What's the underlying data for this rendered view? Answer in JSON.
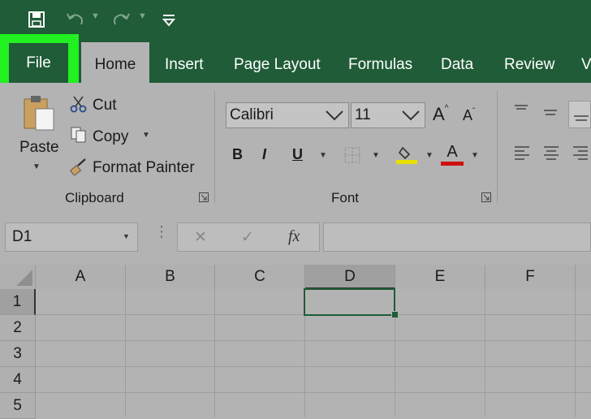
{
  "quick_access": {
    "save_icon": "save-icon",
    "undo_icon": "undo-icon",
    "redo_icon": "redo-icon",
    "customize_icon": "customize-qat-icon"
  },
  "tabs": {
    "file": "File",
    "home": "Home",
    "insert": "Insert",
    "page_layout": "Page Layout",
    "formulas": "Formulas",
    "data": "Data",
    "review": "Review",
    "view_partial": "V"
  },
  "clipboard": {
    "paste": "Paste",
    "cut": "Cut",
    "copy": "Copy",
    "format_painter": "Format Painter",
    "group_label": "Clipboard"
  },
  "font": {
    "family": "Calibri",
    "size": "11",
    "bold": "B",
    "italic": "I",
    "underline": "U",
    "grow": "A",
    "shrink": "A",
    "font_color": "A",
    "group_label": "Font",
    "highlight_color": "#e8e000",
    "font_color_value": "#d01010"
  },
  "formula_bar": {
    "name_box": "D1",
    "cancel": "✕",
    "enter": "✓",
    "fx": "fx",
    "value": ""
  },
  "grid": {
    "columns": [
      "A",
      "B",
      "C",
      "D",
      "E",
      "F"
    ],
    "rows": [
      "1",
      "2",
      "3",
      "4",
      "5"
    ],
    "selected_cell": "D1"
  },
  "colors": {
    "accent": "#1f5c37",
    "highlight": "#21f021"
  }
}
